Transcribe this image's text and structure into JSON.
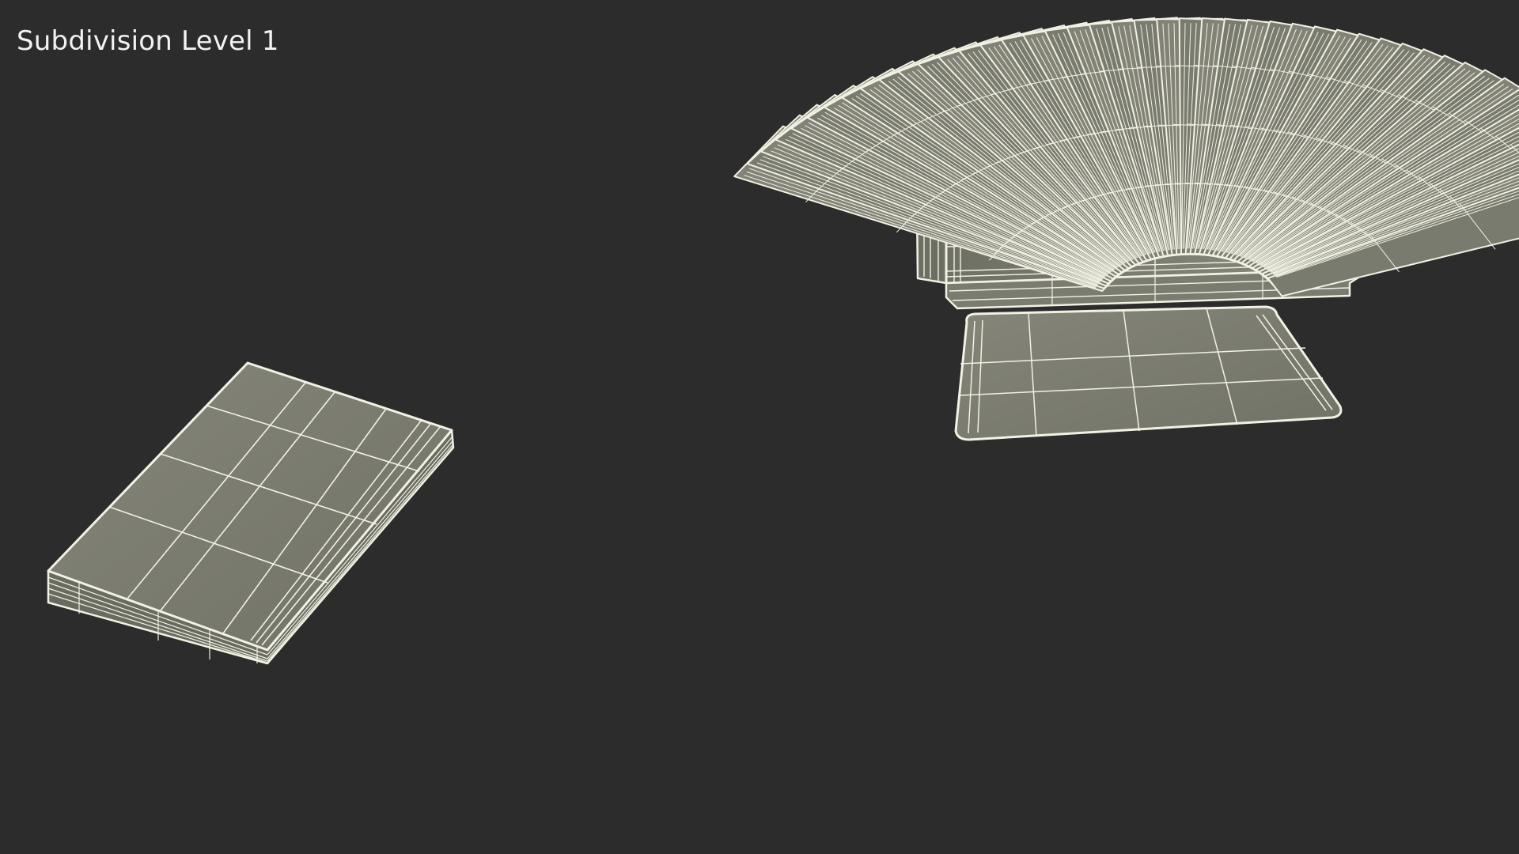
{
  "viewport_label": "Subdivision Level 1",
  "colors": {
    "background": "#2c2c2c",
    "surface": "#7c7d70",
    "surface_dark": "#6e6f63",
    "wire": "#f1f1e4",
    "label": "#f2f2f2"
  },
  "objects": [
    "card-box-lid",
    "card-box-bottom",
    "card-fan",
    "card-stack"
  ]
}
